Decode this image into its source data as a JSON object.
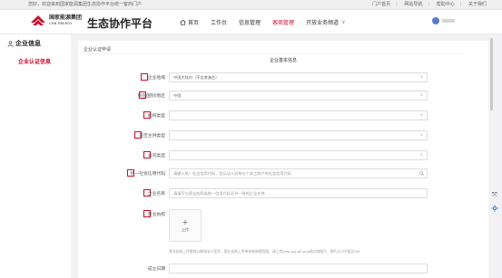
{
  "topbar": {
    "welcome": "您好，欢迎来到国家能源集团生态协作平台统一客商门户",
    "links": [
      "门户首页",
      "网站导航",
      "帮助中心",
      "关于我们"
    ]
  },
  "header": {
    "logo_cn": "国家能源集团",
    "logo_en": "CHN ENERGY",
    "platform_title": "生态协作平台",
    "nav": [
      {
        "label": "首页",
        "icon": "home-icon"
      },
      {
        "label": "工作台"
      },
      {
        "label": "信息管理"
      },
      {
        "label": "客商管理",
        "active": true
      },
      {
        "label": "开放业务频道",
        "dropdown": true
      }
    ],
    "accent_color": "#c8102e"
  },
  "sidebar": {
    "title": "企业信息",
    "title_icon": "user-icon",
    "items": [
      {
        "label": "企业认证信息",
        "active": true
      }
    ]
  },
  "main": {
    "section_title": "企业认证申请",
    "basic_title": "企业基本信息",
    "fields": [
      {
        "label": "企业地域",
        "value": "中国大陆内（不含港澳台）",
        "type": "select"
      },
      {
        "label": "所在国别/地区",
        "value": "中国",
        "type": "select"
      },
      {
        "label": "机构类型",
        "placeholder": "",
        "type": "select"
      },
      {
        "label": "是否主供类型",
        "placeholder": "",
        "type": "select"
      },
      {
        "label": "公司类型",
        "placeholder": "",
        "type": "select"
      },
      {
        "label": "统一社会信用代码",
        "placeholder": "请输入统一社会信用代码，包括法人机构与个体工商户的社会信用代码",
        "type": "search"
      },
      {
        "label": "企业名称",
        "placeholder": "请填写与营业执照或统一信用代码证书一致的企业名称",
        "type": "text"
      }
    ],
    "license": {
      "label": "营业执照",
      "upload_label": "上传",
      "hint": "营业执照上传需附公章和法人签字，营业执照上传单份有效期范围，请上传jpeg,jpg,gif,png格式的图片，图片大小不超过5M"
    },
    "date_label": "成立日期"
  },
  "floaters": {
    "a": "⤧",
    "b": "gear-icon"
  }
}
